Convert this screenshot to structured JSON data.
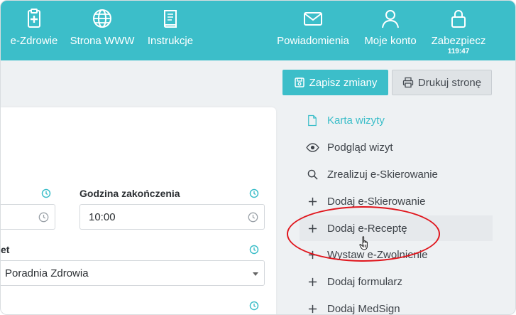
{
  "topnav": {
    "items": [
      {
        "label": "e-Zdrowie",
        "icon": "clipboard-plus-icon"
      },
      {
        "label": "Strona WWW",
        "icon": "globe-icon"
      },
      {
        "label": "Instrukcje",
        "icon": "book-icon"
      },
      {
        "label": "Powiadomienia",
        "icon": "envelope-icon"
      },
      {
        "label": "Moje konto",
        "icon": "user-icon"
      },
      {
        "label": "Zabezpiecz",
        "icon": "lock-icon",
        "sub": "119:47"
      }
    ]
  },
  "toolbar": {
    "save_label": "Zapisz zmiany",
    "print_label": "Drukuj stronę"
  },
  "form": {
    "end_time_label": "Godzina zakończenia",
    "end_time_value": "10:00",
    "cabinet_label_partial": "et",
    "cabinet_value": "Poradnia Zdrowia"
  },
  "side_menu": {
    "items": [
      {
        "label": "Karta wizyty",
        "icon": "document-icon"
      },
      {
        "label": "Podgląd wizyt",
        "icon": "eye-icon"
      },
      {
        "label": "Zrealizuj e-Skierowanie",
        "icon": "search-icon"
      },
      {
        "label": "Dodaj e-Skierowanie",
        "icon": "plus-icon"
      },
      {
        "label": "Dodaj e-Receptę",
        "icon": "plus-icon"
      },
      {
        "label": "Wystaw e-Zwolnienie",
        "icon": "plus-icon"
      },
      {
        "label": "Dodaj formularz",
        "icon": "plus-icon"
      },
      {
        "label": "Dodaj MedSign",
        "icon": "plus-icon"
      }
    ]
  },
  "colors": {
    "accent": "#3cbec9",
    "highlight_ellipse": "#e0161d"
  }
}
